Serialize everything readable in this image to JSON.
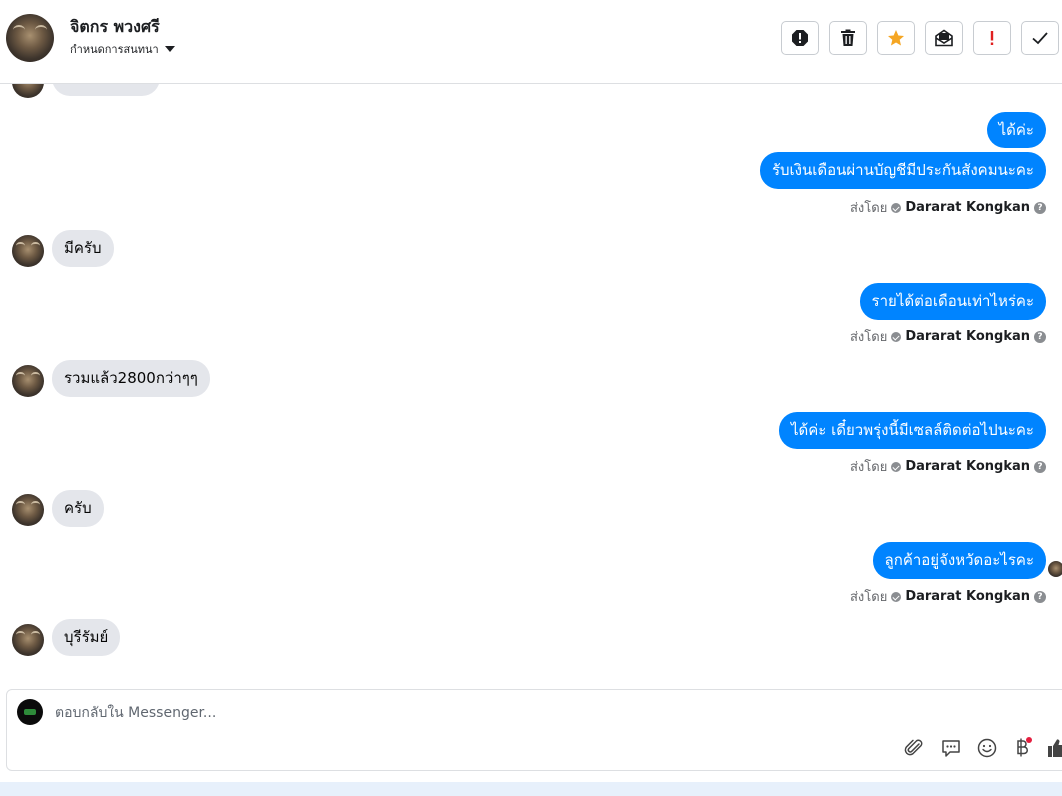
{
  "header": {
    "contact_name": "จิตกร พวงศรี",
    "status_label": "กำหนดการสนทนา",
    "buttons": [
      {
        "name": "spam-icon"
      },
      {
        "name": "trash-icon"
      },
      {
        "name": "star-icon",
        "color": "#f5a623"
      },
      {
        "name": "mark-unread-icon"
      },
      {
        "name": "important-icon",
        "color": "#e02020"
      },
      {
        "name": "checkmark-icon"
      }
    ]
  },
  "conversation": {
    "messages": [
      {
        "direction": "in",
        "text": "มีครับ"
      },
      {
        "direction": "in",
        "text": "รวมแล้ว2800กว่าๆๆ"
      },
      {
        "direction": "in",
        "text": "ครับ"
      },
      {
        "direction": "in",
        "text": "บุรีรัมย์"
      },
      {
        "direction": "out",
        "text": "ได้ค่ะ"
      },
      {
        "direction": "out",
        "text": "รับเงินเดือนผ่านบัญชีมีประกันสังคมนะคะ"
      },
      {
        "direction": "out",
        "text": "รายได้ต่อเดือนเท่าไหร่คะ"
      },
      {
        "direction": "out",
        "text": "ได้ค่ะ เดี๋ยวพรุ่งนี้มีเซลล์ติดต่อไปนะคะ"
      },
      {
        "direction": "out",
        "text": "ลูกค้าอยู่จังหวัดอะไรคะ"
      }
    ],
    "sent_by_prefix": "ส่งโดย",
    "agent_name": "Dararat Kongkan",
    "help_glyph": "?"
  },
  "composer": {
    "placeholder": "ตอบกลับใน Messenger...",
    "icons": [
      "attachment-icon",
      "saved-reply-icon",
      "emoji-icon",
      "baht-icon",
      "thumbs-up-icon"
    ],
    "notification_dot_color": "#e41e3f"
  },
  "colors": {
    "outgoing_bubble": "#0084ff",
    "incoming_bubble": "#e4e6eb"
  }
}
